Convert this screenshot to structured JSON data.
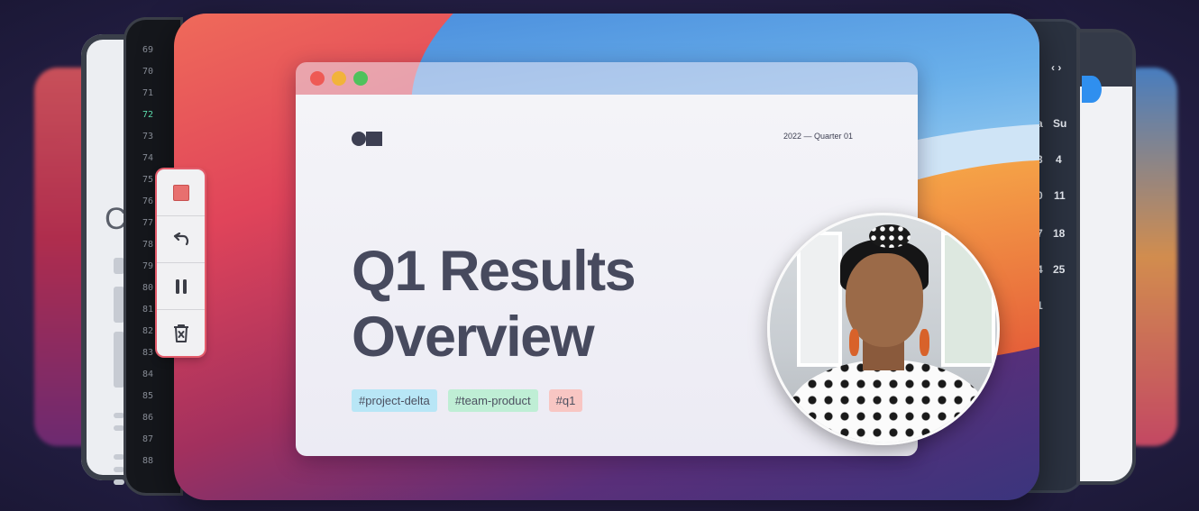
{
  "slide": {
    "date_label": "2022 — Quarter 01",
    "headline_line1": "Q1 Results",
    "headline_line2": "Overview",
    "tags": [
      "#project-delta",
      "#team-product",
      "#q1"
    ]
  },
  "recording_toolbar": {
    "buttons": [
      "stop",
      "undo",
      "pause",
      "delete"
    ],
    "icons": [
      "stop-square-icon",
      "undo-icon",
      "pause-icon",
      "trash-icon"
    ]
  },
  "code_window": {
    "line_numbers": [
      "69",
      "70",
      "71",
      "72",
      "73",
      "74",
      "75",
      "76",
      "77",
      "78",
      "79",
      "80",
      "81",
      "82",
      "83",
      "84",
      "85",
      "86",
      "87",
      "88"
    ],
    "highlighted_line": "72"
  },
  "calendar_window": {
    "nav": "‹ ›",
    "weekday_partial": "a",
    "weekday_sunday": "Su",
    "days": [
      "3",
      "4",
      "0",
      "11",
      "7",
      "18",
      "4",
      "25",
      "1"
    ]
  },
  "colors": {
    "traffic_red": "#ee5a55",
    "traffic_yellow": "#f2b33a",
    "traffic_green": "#4fc25c",
    "tag_blue": "#b8e6f6",
    "tag_green": "#bfeed5",
    "tag_pink": "#f8c6c3",
    "recording_accent": "#e45d6c"
  }
}
